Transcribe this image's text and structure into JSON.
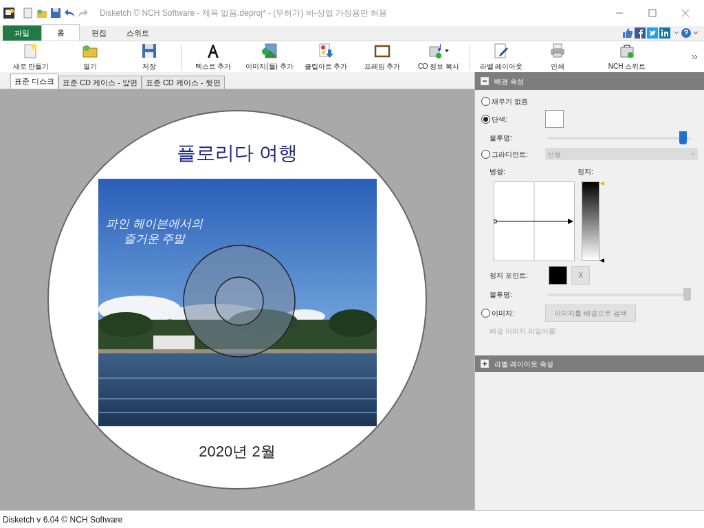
{
  "window": {
    "title": "Disketch © NCH Software - 제목 없음.deproj* - (무허가) 비-상업 가정용만 허용"
  },
  "ribbon_tabs": [
    {
      "label": "파일",
      "kind": "file",
      "selected": false
    },
    {
      "label": "홈",
      "kind": "tab",
      "selected": true
    },
    {
      "label": "편집",
      "kind": "tab",
      "selected": false
    },
    {
      "label": "스위트",
      "kind": "tab",
      "selected": false
    }
  ],
  "toolbar": [
    {
      "label": "새로 만들기",
      "has_menu": false
    },
    {
      "label": "열기",
      "has_menu": false
    },
    {
      "label": "저장",
      "has_menu": false
    },
    {
      "label": "텍스트 추가",
      "has_menu": false
    },
    {
      "label": "이미지(들) 추가",
      "has_menu": false
    },
    {
      "label": "클립아트 추가",
      "has_menu": false
    },
    {
      "label": "프레임 추가",
      "has_menu": false
    },
    {
      "label": "CD 정보 복사",
      "has_menu": true
    },
    {
      "label": "라벨 레이아웃",
      "has_menu": false
    },
    {
      "label": "인쇄",
      "has_menu": false
    },
    {
      "label": "NCH 스위트",
      "has_menu": false
    }
  ],
  "doc_tabs": [
    {
      "label": "표준 디스크",
      "selected": true
    },
    {
      "label": "표준 CD 케이스 - 앞면",
      "selected": false
    },
    {
      "label": "표준 CD 케이스 - 뒷면",
      "selected": false
    }
  ],
  "disc": {
    "title": "플로리다 여행",
    "caption_lines": [
      "파인 헤이븐에서의",
      "즐거운 주말"
    ],
    "date": "2020년 2월"
  },
  "background_panel": {
    "title": "배경 속성",
    "expanded": true,
    "no_fill": {
      "label": "채우기 없음",
      "selected": false
    },
    "solid": {
      "label": "단색:",
      "selected": true,
      "color": "#ffffff"
    },
    "solid_opacity": {
      "label": "불투명:",
      "level": 0.97,
      "disabled": false
    },
    "gradient": {
      "label": "그라디언트:",
      "selected": false,
      "type": "선형",
      "disabled": true
    },
    "direction_label": "방향:",
    "stops_label": "정지:",
    "stop_point": {
      "label": "정지 포인트:",
      "color": "#000000",
      "remove": "X"
    },
    "gradient_opacity": {
      "label": "불투명:",
      "level": 1,
      "disabled": true
    },
    "image": {
      "label": "이미지:",
      "selected": false,
      "button": "이미지를 배경으로 검색",
      "filename_label": "배경 이미지 파일이름:"
    }
  },
  "layout_panel": {
    "title": "라벨 레이아웃 속성",
    "expanded": false
  },
  "status_bar": "Disketch v 6.04 © NCH Software"
}
